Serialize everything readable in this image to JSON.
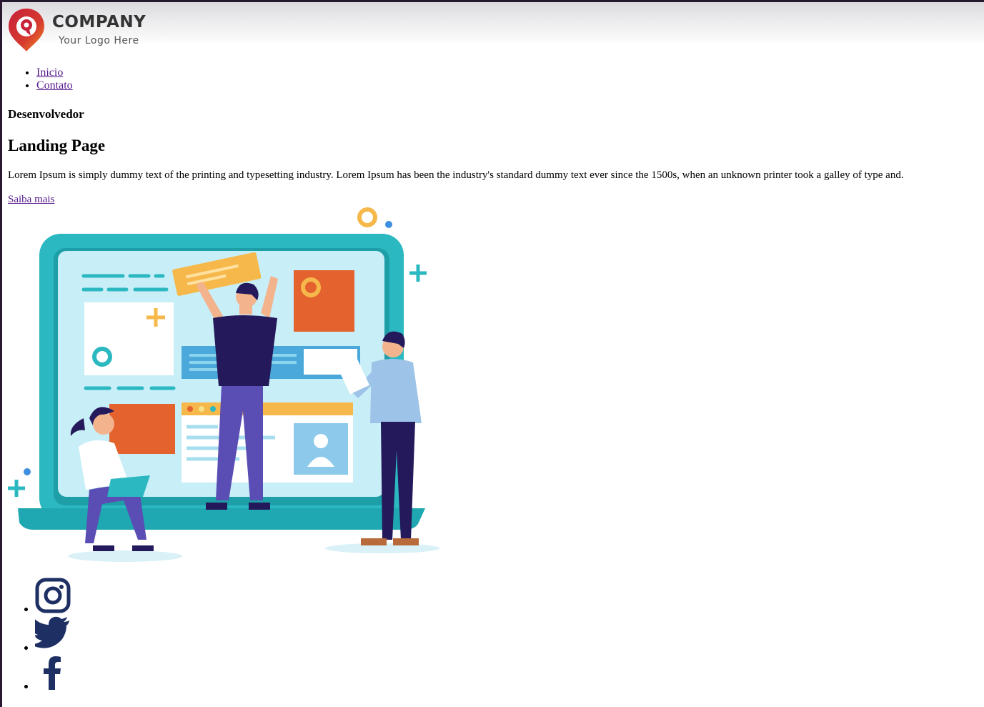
{
  "logo": {
    "wordmark": "COMPANY",
    "tagline": "Your Logo Here"
  },
  "nav": [
    {
      "label": "Inicio"
    },
    {
      "label": "Contato"
    }
  ],
  "hero": {
    "role": "Desenvolvedor",
    "title": "Landing Page",
    "description": "Lorem Ipsum is simply dummy text of the printing and typesetting industry. Lorem Ipsum has been the industry's standard dummy text ever since the 1500s, when an unknown printer took a galley of type and.",
    "cta_label": "Saiba mais"
  },
  "social": [
    {
      "icon": "instagram-icon"
    },
    {
      "icon": "twitter-icon"
    },
    {
      "icon": "facebook-icon"
    }
  ],
  "colors": {
    "link": "#551a8b",
    "teal": "#2bb8c1",
    "orange": "#e3622e",
    "yellow": "#f7b84b",
    "navy": "#24195a",
    "social": "#1e2f63",
    "logo_red": "#c7213a",
    "logo_orange": "#f28c28"
  }
}
